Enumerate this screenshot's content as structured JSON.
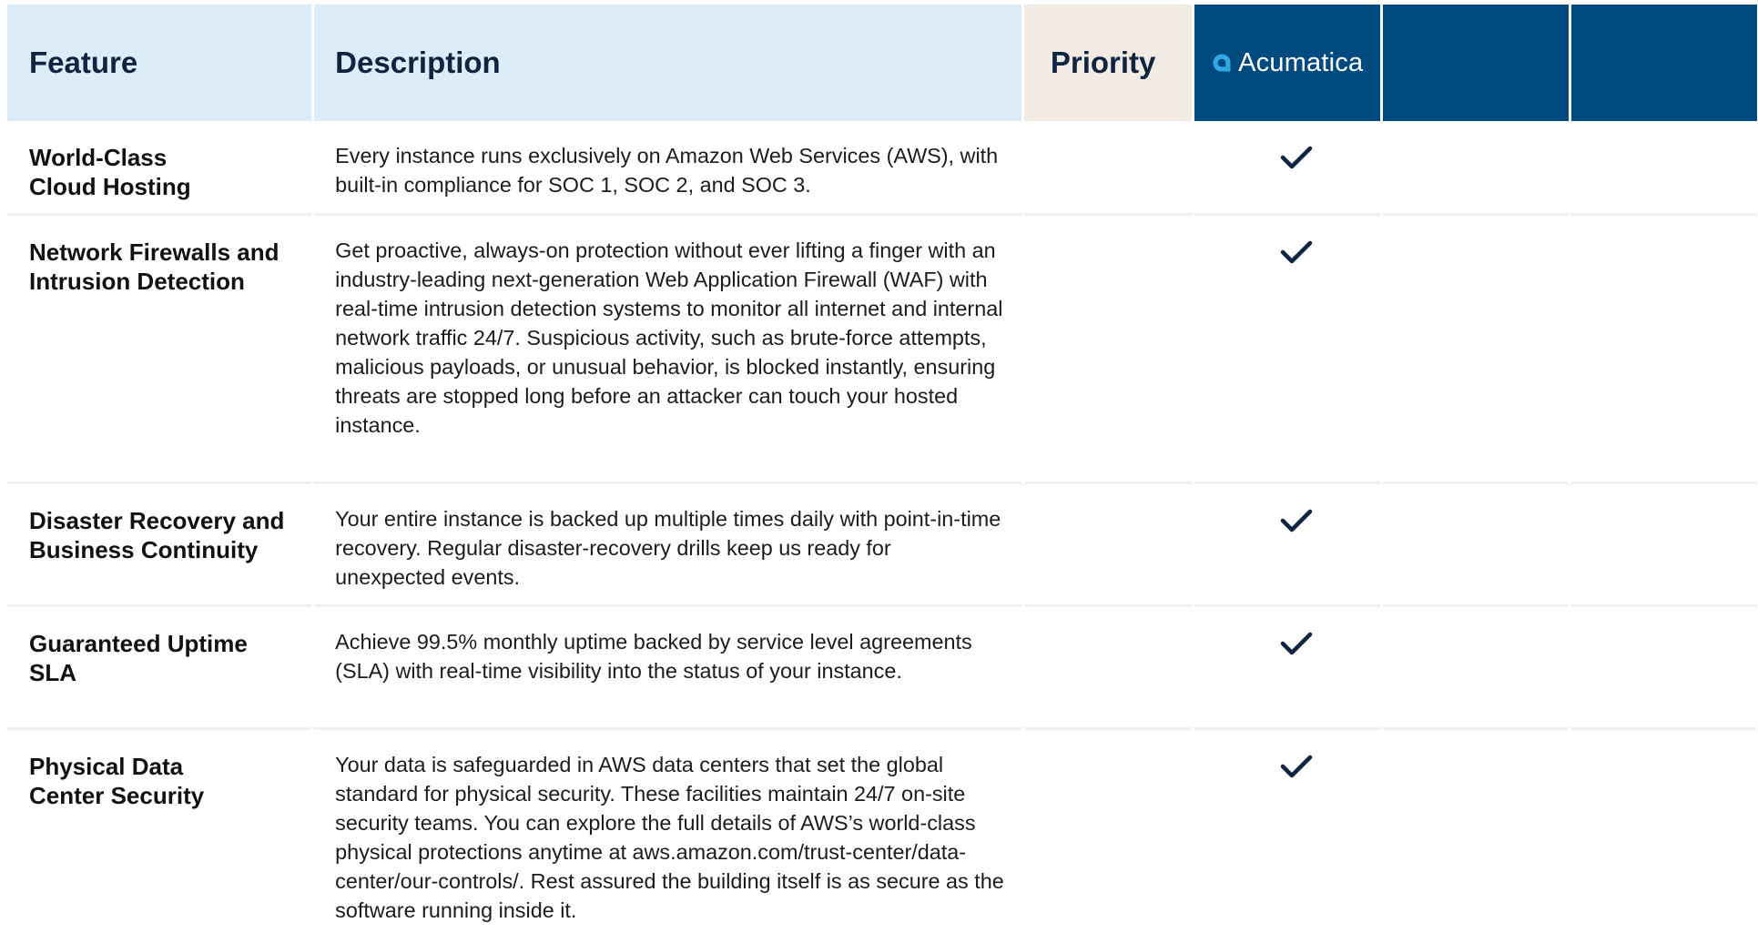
{
  "header": {
    "feature_label": "Feature",
    "description_label": "Description",
    "priority_label": "Priority",
    "vendor_name": "Acumatica",
    "vendor_logo_icon": "acumatica-logo-icon",
    "colors": {
      "light_header_bg": "#dcedf9",
      "priority_header_bg": "#f1ebe4",
      "vendor_header_bg": "#004a80",
      "checkmark": "#0e2440"
    }
  },
  "rows": [
    {
      "feature": [
        "World-Class",
        "Cloud Hosting"
      ],
      "description": "Every instance runs exclusively on Amazon Web Services (AWS), with built-in compliance for SOC 1, SOC 2, and SOC 3.",
      "acumatica": "check-icon"
    },
    {
      "feature": [
        "Network Firewalls and",
        "Intrusion Detection"
      ],
      "description": "Get proactive, always-on protection without ever lifting a finger with an industry-leading next-generation Web Application Firewall (WAF) with real-time intrusion detection systems to monitor all internet and internal network traffic 24/7. Suspicious activity, such as brute-force attempts, malicious payloads, or unusual behavior, is blocked instantly, ensuring threats are stopped long before an attacker can touch your hosted instance.",
      "acumatica": "check-icon"
    },
    {
      "feature": [
        "Disaster Recovery and",
        "Business Continuity"
      ],
      "description": "Your entire instance is backed up multiple times daily with point-in-time recovery. Regular disaster-recovery drills keep us ready for unexpected events.",
      "acumatica": "check-icon"
    },
    {
      "feature": [
        "Guaranteed Uptime",
        "SLA"
      ],
      "description": "Achieve 99.5% monthly uptime backed by service level agreements (SLA) with real-time visibility into the status of your instance.",
      "acumatica": "check-icon"
    },
    {
      "feature": [
        "Physical Data",
        "Center Security"
      ],
      "description": "Your data is safeguarded in AWS data centers that set the global standard for physical security. These facilities maintain 24/7 on-site security teams. You can explore the full details of AWS’s world-class physical protections anytime at aws.amazon.com/trust-center/data-center/our-controls/. Rest assured the building itself is as secure as the software running inside it.",
      "acumatica": "check-icon"
    }
  ]
}
